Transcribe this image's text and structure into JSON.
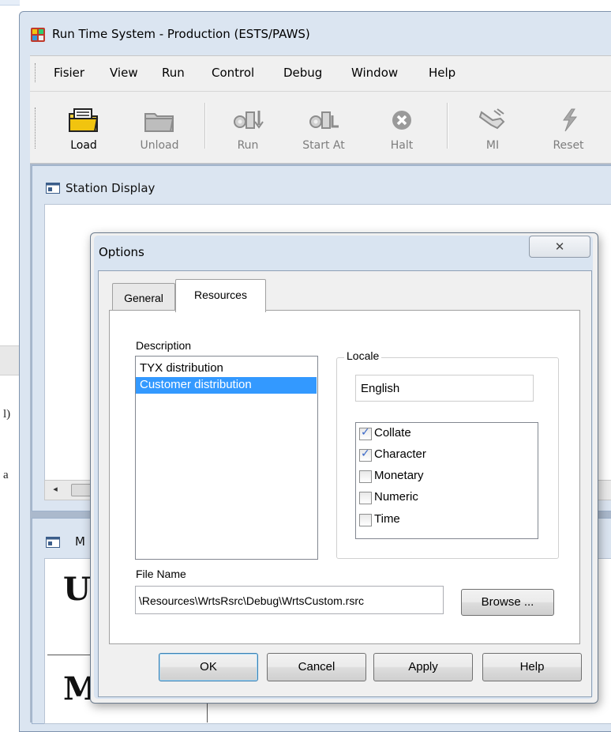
{
  "window": {
    "title": "Run Time System - Production (ESTS/PAWS)"
  },
  "menubar": {
    "items": [
      "Fisier",
      "View",
      "Run",
      "Control",
      "Debug",
      "Window",
      "Help"
    ]
  },
  "toolbar": {
    "buttons": [
      {
        "label": "Load",
        "icon": "load-folder-icon",
        "enabled": true
      },
      {
        "label": "Unload",
        "icon": "unload-folder-icon",
        "enabled": false
      },
      {
        "label": "Run",
        "icon": "run-gears-icon",
        "enabled": false
      },
      {
        "label": "Start At",
        "icon": "start-at-gears-icon",
        "enabled": false
      },
      {
        "label": "Halt",
        "icon": "halt-x-icon",
        "enabled": false
      },
      {
        "label": "MI",
        "icon": "mi-hand-icon",
        "enabled": false
      },
      {
        "label": "Reset",
        "icon": "reset-lightning-icon",
        "enabled": false
      }
    ]
  },
  "behind_window": {
    "text_1": "l)",
    "text_2": "a"
  },
  "station_window": {
    "title": "Station Display",
    "scroll_left": "◂"
  },
  "meas_window": {
    "title": "M",
    "big_text_1": "U",
    "big_text_2": "Meas"
  },
  "dialog": {
    "title": "Options",
    "close_glyph": "✕",
    "tabs": [
      {
        "label": "General",
        "active": false
      },
      {
        "label": "Resources",
        "active": true
      }
    ],
    "description_label": "Description",
    "description_items": [
      {
        "label": "TYX distribution",
        "selected": false
      },
      {
        "label": "Customer distribution",
        "selected": true
      }
    ],
    "locale_label": "Locale",
    "locale_value": "English",
    "categories": [
      {
        "label": "Collate",
        "checked": true
      },
      {
        "label": "Character",
        "checked": true
      },
      {
        "label": "Monetary",
        "checked": false
      },
      {
        "label": "Numeric",
        "checked": false
      },
      {
        "label": "Time",
        "checked": false
      }
    ],
    "file_name_label": "File Name",
    "file_name_value": "\\Resources\\WrtsRsrc\\Debug\\WrtsCustom.rsrc",
    "browse_label": "Browse ...",
    "buttons": {
      "ok": "OK",
      "cancel": "Cancel",
      "apply": "Apply",
      "help": "Help"
    }
  },
  "colors": {
    "selection": "#3399ff",
    "checkmark": "#3a68c8",
    "frame": "#dbe5f1"
  }
}
